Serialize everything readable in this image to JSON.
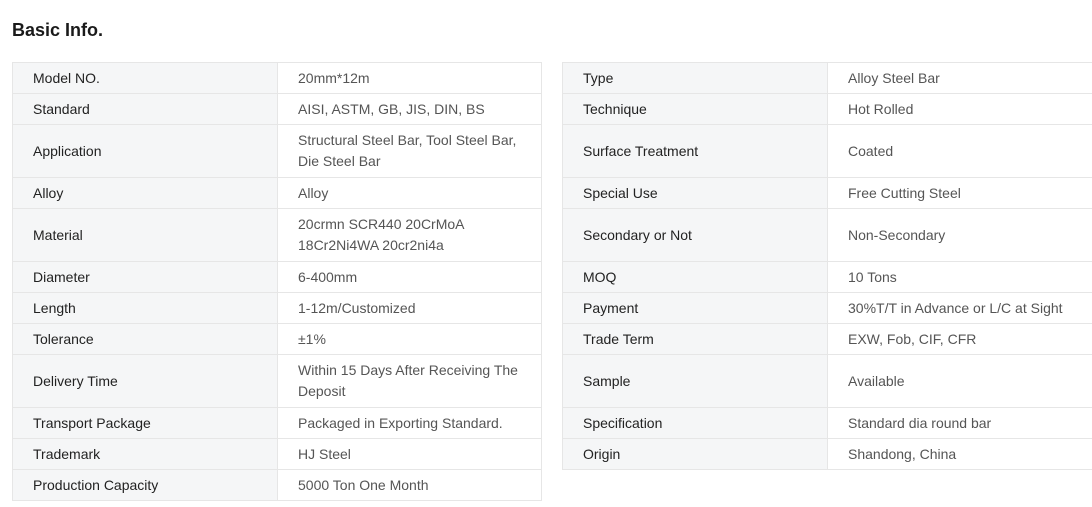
{
  "section": {
    "title": "Basic Info."
  },
  "left_rows": [
    {
      "label": "Model NO.",
      "value": "20mm*12m"
    },
    {
      "label": "Standard",
      "value": "AISI, ASTM, GB, JIS, DIN, BS"
    },
    {
      "label": "Application",
      "value": "Structural Steel Bar, Tool Steel Bar, Die Steel Bar"
    },
    {
      "label": "Alloy",
      "value": "Alloy"
    },
    {
      "label": "Material",
      "value": "20crmn SCR440 20CrMoA 18Cr2Ni4WA 20cr2ni4a"
    },
    {
      "label": "Diameter",
      "value": "6-400mm"
    },
    {
      "label": "Length",
      "value": "1-12m/Customized"
    },
    {
      "label": "Tolerance",
      "value": "±1%"
    },
    {
      "label": "Delivery Time",
      "value": "Within 15 Days After Receiving The Deposit"
    },
    {
      "label": "Transport Package",
      "value": "Packaged in Exporting Standard."
    },
    {
      "label": "Trademark",
      "value": "HJ Steel"
    },
    {
      "label": "Production Capacity",
      "value": "5000 Ton One Month"
    }
  ],
  "right_rows": [
    {
      "label": "Type",
      "value": "Alloy Steel Bar"
    },
    {
      "label": "Technique",
      "value": "Hot Rolled"
    },
    {
      "label": "Surface Treatment",
      "value": "Coated"
    },
    {
      "label": "Special Use",
      "value": "Free Cutting Steel"
    },
    {
      "label": "Secondary or Not",
      "value": "Non-Secondary"
    },
    {
      "label": "MOQ",
      "value": "10 Tons"
    },
    {
      "label": "Payment",
      "value": "30%T/T in Advance or L/C at Sight"
    },
    {
      "label": "Trade Term",
      "value": "EXW, Fob, CIF, CFR"
    },
    {
      "label": "Sample",
      "value": "Available"
    },
    {
      "label": "Specification",
      "value": "Standard dia round bar"
    },
    {
      "label": "Origin",
      "value": "Shandong, China"
    }
  ]
}
